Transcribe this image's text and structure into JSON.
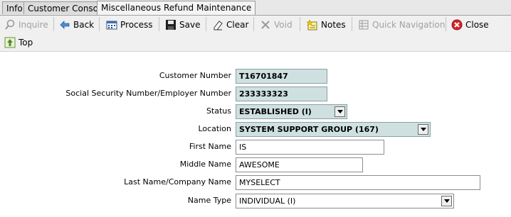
{
  "tabs": [
    {
      "label": "Info"
    },
    {
      "label": "Customer Console"
    },
    {
      "label": "Miscellaneous Refund Maintenance"
    }
  ],
  "toolbar": {
    "inquire": "Inquire",
    "back": "Back",
    "process": "Process",
    "save": "Save",
    "clear": "Clear",
    "void": "Void",
    "notes": "Notes",
    "quick_navigation": "Quick Navigation",
    "close": "Close",
    "top": "Top"
  },
  "form": {
    "customer_number": {
      "label": "Customer Number",
      "value": "T16701847"
    },
    "ssn": {
      "label": "Social Security Number/Employer Number",
      "value": "233333323"
    },
    "status": {
      "label": "Status",
      "value": "ESTABLISHED (I)"
    },
    "location": {
      "label": "Location",
      "value": "SYSTEM SUPPORT GROUP (167)"
    },
    "first_name": {
      "label": "First Name",
      "value": "IS"
    },
    "middle_name": {
      "label": "Middle Name",
      "value": "AWESOME"
    },
    "last_name": {
      "label": "Last Name/Company Name",
      "value": "MYSELECT"
    },
    "name_type": {
      "label": "Name Type",
      "value": "INDIVIDUAL (I)"
    }
  },
  "colors": {
    "readonly_field": "#cfe0e1",
    "toolbar_bg": "#f0f0f0",
    "close_icon": "#d9232a"
  },
  "icons": [
    "search-icon",
    "back-arrow-icon",
    "process-icon",
    "save-icon",
    "eraser-icon",
    "void-x-icon",
    "notes-icon",
    "quick-navigation-icon",
    "close-icon",
    "top-icon",
    "dropdown-arrow-icon"
  ]
}
